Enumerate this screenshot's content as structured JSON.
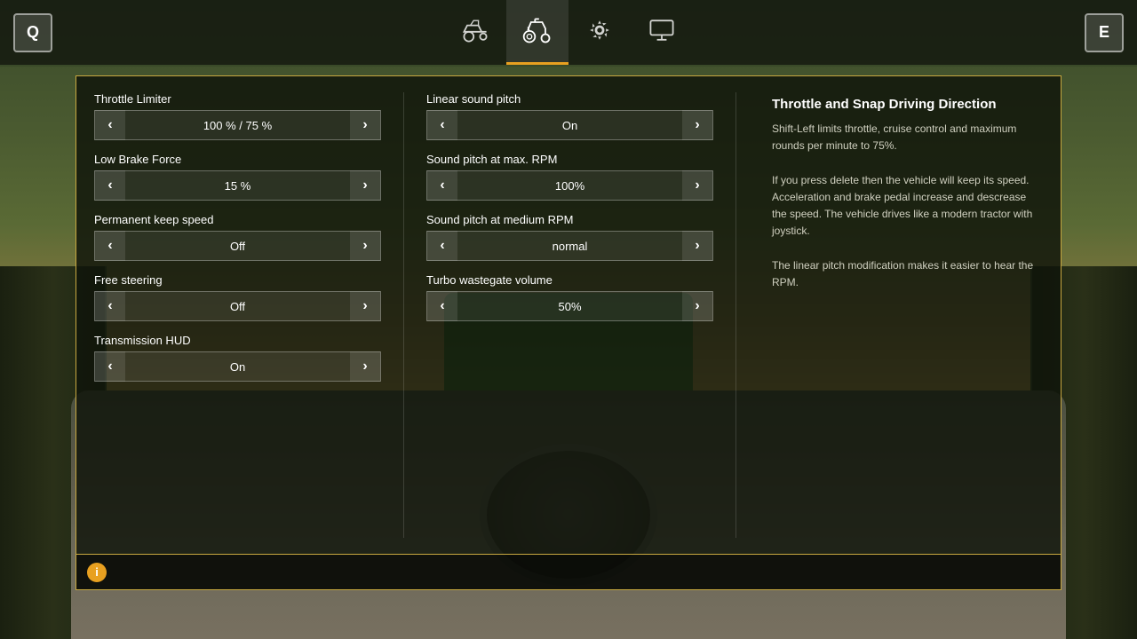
{
  "topbar": {
    "key_left": "Q",
    "key_right": "E",
    "tabs": [
      {
        "id": "tab-vehicle",
        "label": "Vehicle",
        "active": false
      },
      {
        "id": "tab-tractor",
        "label": "Tractor",
        "active": true
      },
      {
        "id": "tab-settings",
        "label": "Settings",
        "active": false
      },
      {
        "id": "tab-display",
        "label": "Display",
        "active": false
      }
    ]
  },
  "settings": {
    "left_col": [
      {
        "id": "throttle-limiter",
        "label": "Throttle Limiter",
        "value": "100 % / 75 %"
      },
      {
        "id": "low-brake-force",
        "label": "Low Brake Force",
        "value": "15 %"
      },
      {
        "id": "permanent-keep-speed",
        "label": "Permanent keep speed",
        "value": "Off"
      },
      {
        "id": "free-steering",
        "label": "Free steering",
        "value": "Off"
      },
      {
        "id": "transmission-hud",
        "label": "Transmission HUD",
        "value": "On"
      }
    ],
    "right_col": [
      {
        "id": "linear-sound-pitch",
        "label": "Linear sound pitch",
        "value": "On"
      },
      {
        "id": "sound-pitch-max-rpm",
        "label": "Sound pitch at max. RPM",
        "value": "100%"
      },
      {
        "id": "sound-pitch-medium-rpm",
        "label": "Sound pitch at medium RPM",
        "value": "normal"
      },
      {
        "id": "turbo-wastegate-volume",
        "label": "Turbo wastegate volume",
        "value": "50%"
      }
    ],
    "description": {
      "title": "Throttle and Snap Driving Direction",
      "text": "Shift-Left limits throttle, cruise control and maximum rounds per minute to 75%.\nIf you press delete then the vehicle will keep its speed. Acceleration and brake pedal increase and descrease the speed. The vehicle drives like a modern tractor with joystick.\nThe linear pitch modification makes it easier to hear the RPM."
    }
  },
  "status_bar": {
    "icon": "i",
    "text": ""
  },
  "icons": {
    "chevron_left": "‹",
    "chevron_right": "›"
  }
}
